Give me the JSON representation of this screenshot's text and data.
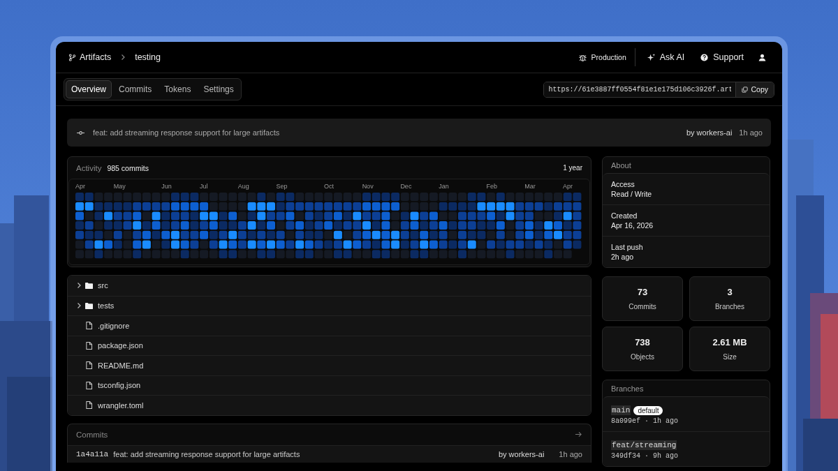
{
  "breadcrumb": {
    "repo": "Artifacts",
    "name": "testing"
  },
  "header_actions": [
    {
      "kind": "env",
      "label": "Production"
    },
    {
      "kind": "ai",
      "label": "Ask AI"
    },
    {
      "kind": "support",
      "label": "Support"
    },
    {
      "kind": "user"
    }
  ],
  "tabs": [
    {
      "label": "Overview",
      "selected": true
    },
    {
      "label": "Commits",
      "selected": false
    },
    {
      "label": "Tokens",
      "selected": false
    },
    {
      "label": "Settings",
      "selected": false
    }
  ],
  "clone_url": {
    "value": "https://61e3887ff0554f81e1e175d106c3926f.art",
    "button": "Copy"
  },
  "latest_commit": {
    "message": "feat: add streaming response support for large artifacts",
    "author": "by workers-ai",
    "time": "1h ago"
  },
  "activity": {
    "title": "Activity",
    "count": "985 commits",
    "range": "1 year",
    "months": [
      "Apr",
      "May",
      "Jun",
      "Jul",
      "Aug",
      "Sep",
      "Oct",
      "Nov",
      "Dec",
      "Jan",
      "Feb",
      "Mar",
      "Apr"
    ]
  },
  "files": [
    {
      "kind": "folder",
      "name": "src",
      "expanded": false
    },
    {
      "kind": "folder",
      "name": "tests",
      "expanded": false
    },
    {
      "kind": "file",
      "name": ".gitignore"
    },
    {
      "kind": "file",
      "name": "package.json"
    },
    {
      "kind": "file",
      "name": "README.md"
    },
    {
      "kind": "file",
      "name": "tsconfig.json"
    },
    {
      "kind": "file",
      "name": "wrangler.toml"
    }
  ],
  "commits": {
    "title": "Commits",
    "rows": [
      {
        "hash": "1a4a11a",
        "message": "feat: add streaming response support for large artifacts",
        "author": "by workers-ai",
        "time": "1h ago"
      }
    ]
  },
  "about": {
    "title": "About",
    "fields": [
      {
        "label": "Access",
        "value": "Read / Write"
      },
      {
        "label": "Created",
        "value": "Apr 16, 2026"
      },
      {
        "label": "Last push",
        "value": "2h ago"
      }
    ]
  },
  "stats": [
    {
      "value": "73",
      "label": "Commits"
    },
    {
      "value": "3",
      "label": "Branches"
    },
    {
      "value": "738",
      "label": "Objects"
    },
    {
      "value": "2.61 MB",
      "label": "Size"
    }
  ],
  "branches": {
    "title": "Branches",
    "items": [
      {
        "name": "main",
        "badge": "default",
        "meta": "8a099ef · 1h ago"
      },
      {
        "name": "feat/streaming",
        "meta": "349df34 · 9h ago"
      }
    ]
  }
}
